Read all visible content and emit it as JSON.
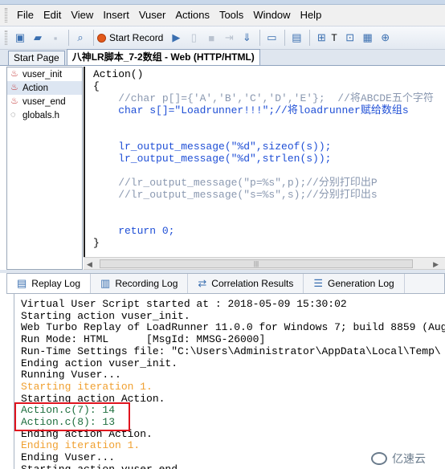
{
  "menu": [
    "File",
    "Edit",
    "View",
    "Insert",
    "Vuser",
    "Actions",
    "Tools",
    "Window",
    "Help"
  ],
  "toolbar": {
    "start_record": "Start Record",
    "t_label": "T"
  },
  "tabs": [
    {
      "label": "Start Page"
    },
    {
      "label": "八神LR脚本_7-2数组 - Web (HTTP/HTML)"
    }
  ],
  "tree": [
    "vuser_init",
    "Action",
    "vuser_end",
    "globals.h"
  ],
  "code": [
    {
      "text": "Action()",
      "color": "#000000"
    },
    {
      "text": "{",
      "color": "#000000"
    },
    {
      "text": "    //char p[]={'A','B','C','D','E'};  //将ABCDE五个字符",
      "color": "#8a98b0"
    },
    {
      "text": "    char s[]=\"Loadrunner!!!\";//将loadrunner赋给数组s",
      "color": "#1f4fd6"
    },
    {
      "text": "",
      "color": "#000000"
    },
    {
      "text": "",
      "color": "#000000"
    },
    {
      "text": "    lr_output_message(\"%d\",sizeof(s));",
      "color": "#1f4fd6"
    },
    {
      "text": "    lr_output_message(\"%d\",strlen(s));",
      "color": "#1f4fd6"
    },
    {
      "text": "",
      "color": "#000000"
    },
    {
      "text": "    //lr_output_message(\"p=%s\",p);//分别打印出P",
      "color": "#8a98b0"
    },
    {
      "text": "    //lr_output_message(\"s=%s\",s);//分别打印出s",
      "color": "#8a98b0"
    },
    {
      "text": "",
      "color": "#000000"
    },
    {
      "text": "",
      "color": "#000000"
    },
    {
      "text": "    return 0;",
      "color": "#1f4fd6"
    },
    {
      "text": "}",
      "color": "#000000"
    }
  ],
  "output_tabs": [
    {
      "label": "Replay Log",
      "icon": "▤"
    },
    {
      "label": "Recording Log",
      "icon": "▥"
    },
    {
      "label": "Correlation Results",
      "icon": "⇄"
    },
    {
      "label": "Generation Log",
      "icon": "☰"
    }
  ],
  "log": [
    {
      "text": "Virtual User Script started at : 2018-05-09 15:30:02",
      "color": "#000000"
    },
    {
      "text": "Starting action vuser_init.",
      "color": "#000000"
    },
    {
      "text": "Web Turbo Replay of LoadRunner 11.0.0 for Windows 7; build 8859 (Aug",
      "color": "#000000"
    },
    {
      "text": "Run Mode: HTML      [MsgId: MMSG-26000]",
      "color": "#000000"
    },
    {
      "text": "Run-Time Settings file: \"C:\\Users\\Administrator\\AppData\\Local\\Temp\\",
      "color": "#000000"
    },
    {
      "text": "Ending action vuser_init.",
      "color": "#000000"
    },
    {
      "text": "Running Vuser...",
      "color": "#000000"
    },
    {
      "text": "Starting iteration 1.",
      "color": "#f0a030"
    },
    {
      "text": "Starting action Action.",
      "color": "#000000"
    },
    {
      "text": "Action.c(7): 14",
      "color": "#1f6f3f"
    },
    {
      "text": "Action.c(8): 13",
      "color": "#1f6f3f"
    },
    {
      "text": "Ending action Action.",
      "color": "#000000"
    },
    {
      "text": "Ending iteration 1.",
      "color": "#f0a030"
    },
    {
      "text": "Ending Vuser...",
      "color": "#000000"
    },
    {
      "text": "Starting action vuser_end.",
      "color": "#000000"
    }
  ],
  "watermark": "亿速云"
}
